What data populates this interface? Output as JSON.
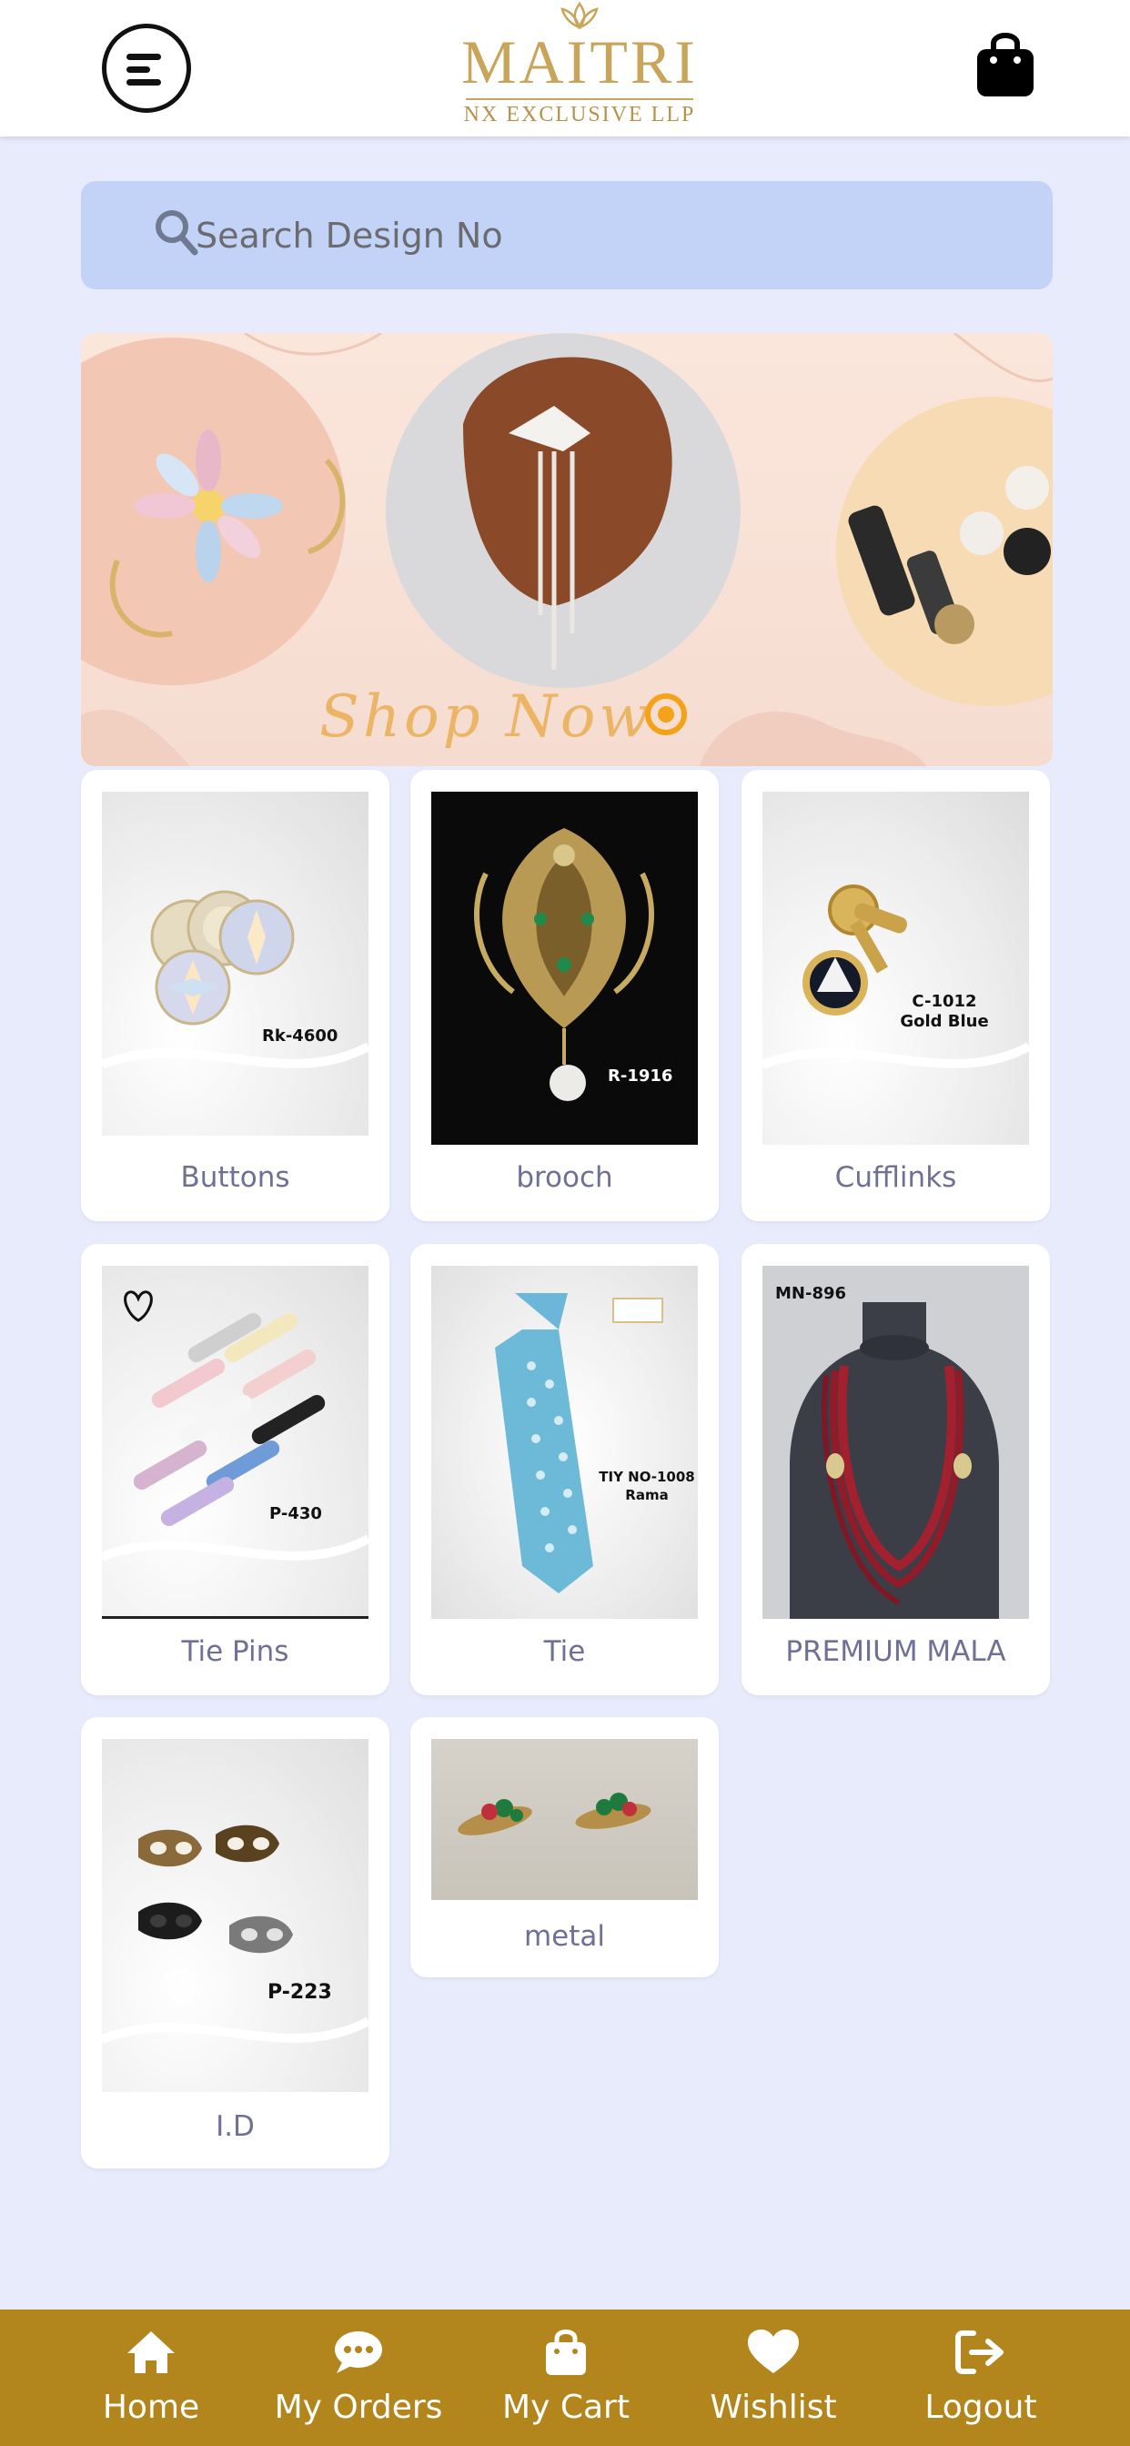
{
  "header": {
    "logo_main": "MAITRI",
    "logo_sub": "NX EXCLUSIVE LLP"
  },
  "search": {
    "placeholder": "Search Design No"
  },
  "banner": {
    "cta": "Shop Now"
  },
  "categories": [
    {
      "label": "Buttons",
      "code": "Rk-4600"
    },
    {
      "label": "brooch",
      "code": "R-1916"
    },
    {
      "label": "Cufflinks",
      "code": "C-1012\nGold Blue"
    },
    {
      "label": "Tie Pins",
      "code": "P-430"
    },
    {
      "label": "Tie",
      "code": "TIY NO-1008\nRama"
    },
    {
      "label": "PREMIUM MALA",
      "code": "MN-896"
    },
    {
      "label": "I.D",
      "code": "P-223"
    },
    {
      "label": "metal",
      "code": ""
    }
  ],
  "bottom_nav": [
    {
      "label": "Home",
      "icon": "home-icon"
    },
    {
      "label": "My Orders",
      "icon": "chat-icon"
    },
    {
      "label": "My Cart",
      "icon": "bag-icon"
    },
    {
      "label": "Wishlist",
      "icon": "heart-icon"
    },
    {
      "label": "Logout",
      "icon": "logout-icon"
    }
  ],
  "colors": {
    "background": "#e8ebfb",
    "search_bg": "#c2d3f7",
    "brand_gold": "#b3861d",
    "logo_gold": "#c9a55c",
    "label_text": "#6e7096"
  }
}
